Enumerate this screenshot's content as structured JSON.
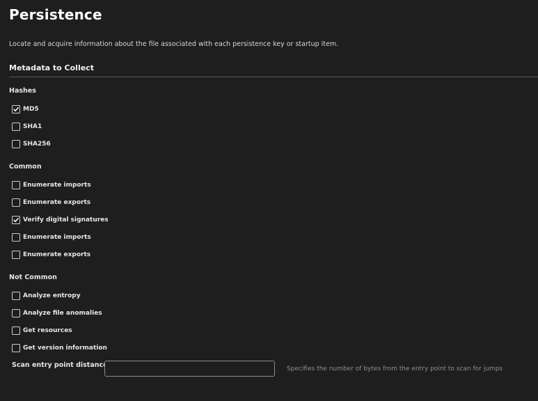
{
  "page": {
    "title": "Persistence",
    "description": "Locate and acquire information about the file associated with each persistence key or startup item."
  },
  "section": {
    "title": "Metadata to Collect"
  },
  "groups": {
    "hashes": {
      "label": "Hashes",
      "options": [
        {
          "label": "MD5",
          "checked": true
        },
        {
          "label": "SHA1",
          "checked": false
        },
        {
          "label": "SHA256",
          "checked": false
        }
      ]
    },
    "common": {
      "label": "Common",
      "options": [
        {
          "label": "Enumerate imports",
          "checked": false
        },
        {
          "label": "Enumerate exports",
          "checked": false
        },
        {
          "label": "Verify digital signatures",
          "checked": true
        },
        {
          "label": "Enumerate imports",
          "checked": false
        },
        {
          "label": "Enumerate exports",
          "checked": false
        }
      ]
    },
    "not_common": {
      "label": "Not Common",
      "options": [
        {
          "label": "Analyze entropy",
          "checked": false
        },
        {
          "label": "Analyze file anomalies",
          "checked": false
        },
        {
          "label": "Get resources",
          "checked": false
        },
        {
          "label": "Get version information",
          "checked": false
        }
      ]
    }
  },
  "scan_field": {
    "label": "Scan entry point distance:",
    "value": "",
    "placeholder": "",
    "hint": "Specifies the number of bytes from the entry point to scan for jumps"
  }
}
